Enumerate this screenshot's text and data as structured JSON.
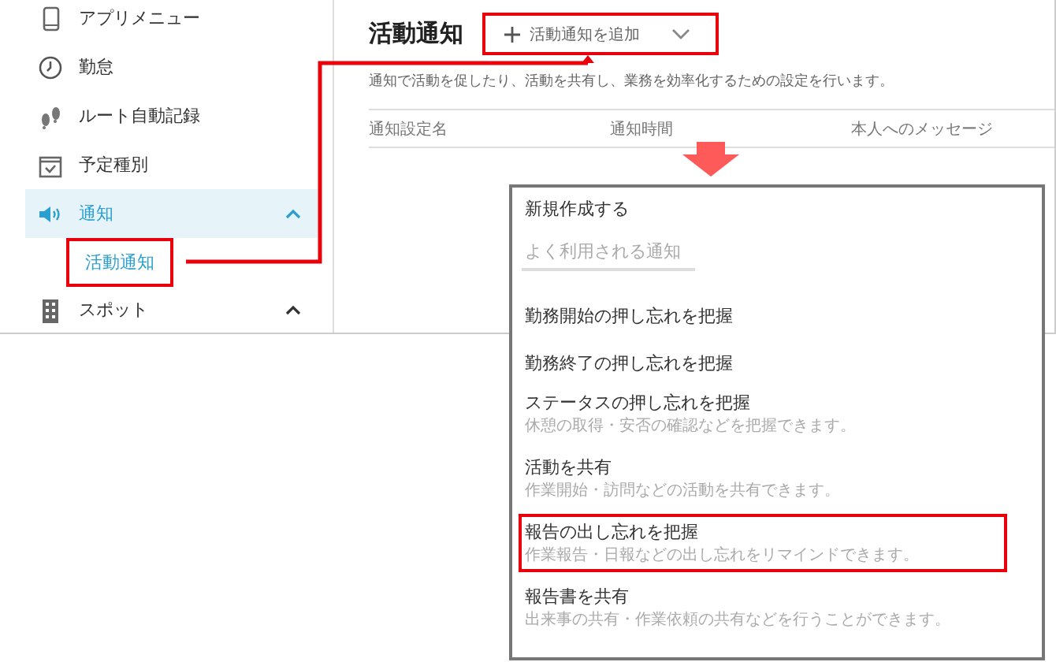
{
  "sidebar": {
    "items": [
      {
        "label": "アプリメニュー",
        "selected": false
      },
      {
        "label": "勤怠",
        "selected": false
      },
      {
        "label": "ルート自動記録",
        "selected": false
      },
      {
        "label": "予定種別",
        "selected": false
      },
      {
        "label": "通知",
        "selected": true,
        "expanded": true,
        "children": [
          {
            "label": "活動通知",
            "selected": true,
            "highlighted": true
          }
        ]
      },
      {
        "label": "スポット",
        "selected": false,
        "expanded": true
      }
    ]
  },
  "page": {
    "title": "活動通知",
    "add_button": {
      "label": "活動通知を追加",
      "highlighted": true
    },
    "description": "通知で活動を促したり、活動を共有し、業務を効率化するための設定を行います。",
    "table": {
      "columns": [
        "通知設定名",
        "通知時間",
        "本人へのメッセージ"
      ]
    }
  },
  "dropdown": {
    "items": [
      {
        "kind": "action",
        "title": "新規作成する"
      },
      {
        "kind": "header",
        "title": "よく利用される通知"
      },
      {
        "kind": "option",
        "title": "勤務開始の押し忘れを把握",
        "highlighted": false
      },
      {
        "kind": "option",
        "title": "勤務終了の押し忘れを把握",
        "highlighted": false
      },
      {
        "kind": "option",
        "title": "ステータスの押し忘れを把握",
        "description": "休憩の取得・安否の確認などを把握できます。",
        "highlighted": false
      },
      {
        "kind": "option",
        "title": "活動を共有",
        "description": "作業開始・訪問などの活動を共有できます。",
        "highlighted": false
      },
      {
        "kind": "option",
        "title": "報告の出し忘れを把握",
        "description": "作業報告・日報などの出し忘れをリマインドできます。",
        "highlighted": true
      },
      {
        "kind": "option",
        "title": "報告書を共有",
        "description": "出来事の共有・作業依頼の共有などを行うことができます。",
        "highlighted": false
      }
    ]
  }
}
